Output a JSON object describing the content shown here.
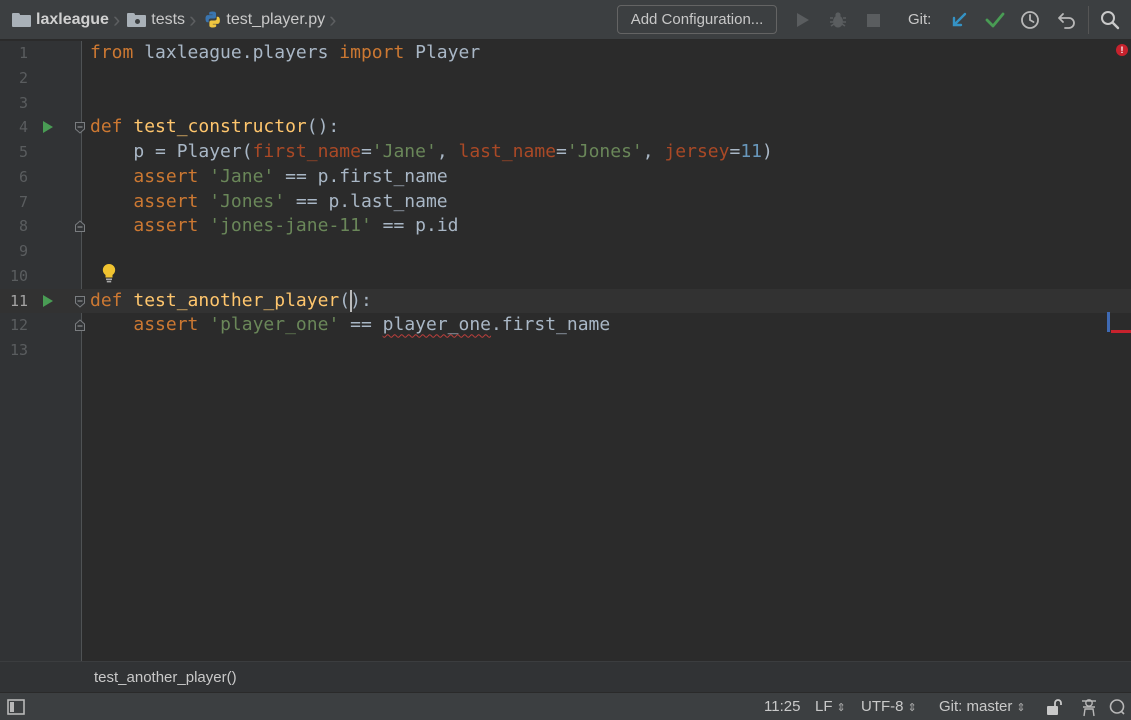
{
  "toolbar": {
    "breadcrumbs": [
      {
        "label": "laxleague",
        "icon": "folder-icon"
      },
      {
        "label": "tests",
        "icon": "package-folder-icon"
      },
      {
        "label": "test_player.py",
        "icon": "python-file-icon"
      }
    ],
    "add_configuration_label": "Add Configuration...",
    "git_label": "Git:",
    "icons": [
      "run-icon",
      "debug-icon",
      "stop-icon",
      "vcs-update-icon",
      "vcs-commit-icon",
      "history-icon",
      "rollback-icon",
      "search-icon"
    ]
  },
  "editor": {
    "line_numbers": [
      "1",
      "2",
      "3",
      "4",
      "5",
      "6",
      "7",
      "8",
      "9",
      "10",
      "11",
      "12",
      "13"
    ],
    "lines": [
      {
        "tokens": [
          {
            "t": "kw",
            "v": "from"
          },
          {
            "t": "pl",
            "v": " laxleague.players "
          },
          {
            "t": "kw",
            "v": "import"
          },
          {
            "t": "pl",
            "v": " Player"
          }
        ]
      },
      {
        "tokens": []
      },
      {
        "tokens": []
      },
      {
        "tokens": [
          {
            "t": "kw",
            "v": "def"
          },
          {
            "t": "pl",
            "v": " "
          },
          {
            "t": "fn",
            "v": "test_constructor"
          },
          {
            "t": "pl",
            "v": "():"
          }
        ],
        "run": true,
        "fold": "start"
      },
      {
        "tokens": [
          {
            "t": "pl",
            "v": "    p = Player("
          },
          {
            "t": "par",
            "v": "first_name"
          },
          {
            "t": "pl",
            "v": "="
          },
          {
            "t": "str",
            "v": "'Jane'"
          },
          {
            "t": "pl",
            "v": ", "
          },
          {
            "t": "par",
            "v": "last_name"
          },
          {
            "t": "pl",
            "v": "="
          },
          {
            "t": "str",
            "v": "'Jones'"
          },
          {
            "t": "pl",
            "v": ", "
          },
          {
            "t": "par",
            "v": "jersey"
          },
          {
            "t": "pl",
            "v": "="
          },
          {
            "t": "num",
            "v": "11"
          },
          {
            "t": "pl",
            "v": ")"
          }
        ]
      },
      {
        "tokens": [
          {
            "t": "pl",
            "v": "    "
          },
          {
            "t": "kw",
            "v": "assert"
          },
          {
            "t": "pl",
            "v": " "
          },
          {
            "t": "str",
            "v": "'Jane'"
          },
          {
            "t": "pl",
            "v": " == p.first_name"
          }
        ]
      },
      {
        "tokens": [
          {
            "t": "pl",
            "v": "    "
          },
          {
            "t": "kw",
            "v": "assert"
          },
          {
            "t": "pl",
            "v": " "
          },
          {
            "t": "str",
            "v": "'Jones'"
          },
          {
            "t": "pl",
            "v": " == p.last_name"
          }
        ]
      },
      {
        "tokens": [
          {
            "t": "pl",
            "v": "    "
          },
          {
            "t": "kw",
            "v": "assert"
          },
          {
            "t": "pl",
            "v": " "
          },
          {
            "t": "str",
            "v": "'jones-jane-11'"
          },
          {
            "t": "pl",
            "v": " == p.id"
          }
        ],
        "fold": "end"
      },
      {
        "tokens": []
      },
      {
        "tokens": [],
        "bulb": true
      },
      {
        "tokens": [
          {
            "t": "kw",
            "v": "def"
          },
          {
            "t": "pl",
            "v": " "
          },
          {
            "t": "fn",
            "v": "test_another_player"
          },
          {
            "t": "pl",
            "v": "():"
          }
        ],
        "run": true,
        "fold": "start",
        "current": true
      },
      {
        "tokens": [
          {
            "t": "pl",
            "v": "    "
          },
          {
            "t": "kw",
            "v": "assert"
          },
          {
            "t": "pl",
            "v": " "
          },
          {
            "t": "str",
            "v": "'player_one'"
          },
          {
            "t": "pl",
            "v": " == "
          },
          {
            "t": "err",
            "v": "player_one"
          },
          {
            "t": "pl",
            "v": ".first_name"
          }
        ],
        "fold": "end"
      },
      {
        "tokens": []
      }
    ],
    "caret_line": 11,
    "caret_column": 25
  },
  "breadcrumb_bar": {
    "text": "test_another_player()"
  },
  "statusbar": {
    "position": "11:25",
    "line_separator": "LF",
    "encoding": "UTF-8",
    "vcs_branch": "Git: master",
    "updown_glyph": "⇕",
    "icons": [
      "tool-windows-icon",
      "lock-icon",
      "inspector-icon",
      "event-log-icon"
    ]
  },
  "colors": {
    "background": "#2b2b2b",
    "keyword": "#cc7832",
    "function": "#ffc66d",
    "string": "#6a8759",
    "number": "#6897bb",
    "parameter": "#aa4926",
    "run_green": "#499c54",
    "error_red": "#c7222d",
    "vcs_blue": "#3592c4"
  }
}
